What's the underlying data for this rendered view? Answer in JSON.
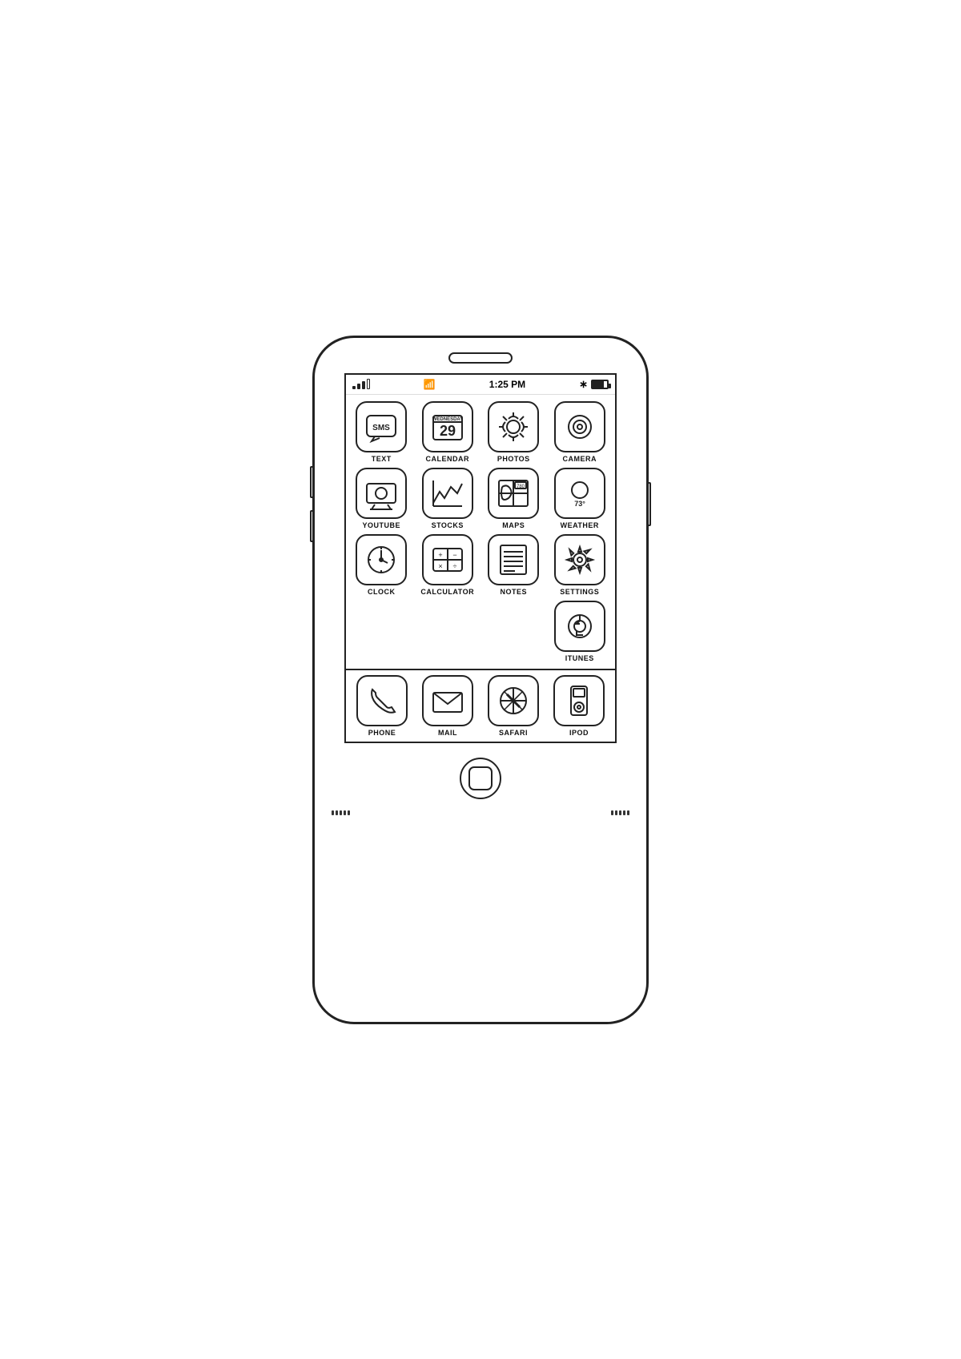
{
  "phone": {
    "status_bar": {
      "time": "1:25 PM"
    },
    "apps": [
      {
        "id": "text",
        "label": "TEXT"
      },
      {
        "id": "calendar",
        "label": "CALENDAR",
        "day": "29",
        "weekday": "WEDNESDAY"
      },
      {
        "id": "photos",
        "label": "PHOTOS"
      },
      {
        "id": "camera",
        "label": "CAMERA"
      },
      {
        "id": "youtube",
        "label": "YOUTUBE"
      },
      {
        "id": "stocks",
        "label": "STOCKS"
      },
      {
        "id": "maps",
        "label": "MAPS"
      },
      {
        "id": "weather",
        "label": "WEATHER",
        "temp": "73°"
      },
      {
        "id": "clock",
        "label": "CLOCK"
      },
      {
        "id": "calculator",
        "label": "CALCULATOR"
      },
      {
        "id": "notes",
        "label": "NOTES"
      },
      {
        "id": "settings",
        "label": "SETTINGS"
      }
    ],
    "itunes": {
      "label": "ITUNES"
    },
    "dock": [
      {
        "id": "phone",
        "label": "PHONE"
      },
      {
        "id": "mail",
        "label": "MAIL"
      },
      {
        "id": "safari",
        "label": "SAFARI"
      },
      {
        "id": "ipod",
        "label": "IPOD"
      }
    ]
  }
}
